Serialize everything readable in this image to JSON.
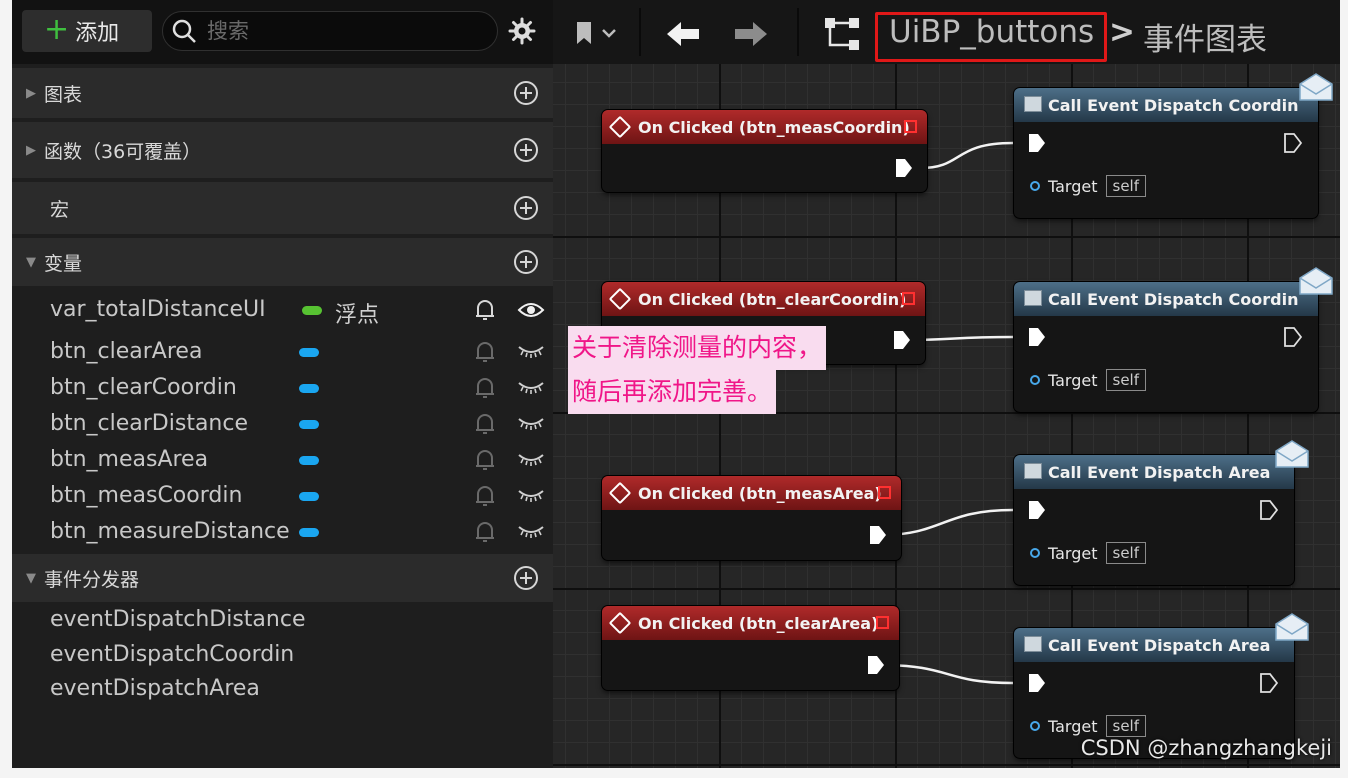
{
  "toolbar": {
    "add_label": "添加",
    "search_placeholder": "搜索"
  },
  "sections": {
    "graphs": "图表",
    "functions": "函数（36可覆盖）",
    "macros": "宏",
    "variables": "变量",
    "dispatchers": "事件分发器"
  },
  "variables": [
    {
      "name": "var_totalDistanceUI",
      "type_label": "浮点",
      "type_color": "#57c232"
    },
    {
      "name": "btn_clearArea",
      "type_color": "#1aa6f0"
    },
    {
      "name": "btn_clearCoordin",
      "type_color": "#1aa6f0"
    },
    {
      "name": "btn_clearDistance",
      "type_color": "#1aa6f0"
    },
    {
      "name": "btn_measArea",
      "type_color": "#1aa6f0"
    },
    {
      "name": "btn_measCoordin",
      "type_color": "#1aa6f0"
    },
    {
      "name": "btn_measureDistance",
      "type_color": "#1aa6f0"
    }
  ],
  "event_dispatchers": [
    "eventDispatchDistance",
    "eventDispatchCoordin",
    "eventDispatchArea"
  ],
  "breadcrumb": {
    "blueprint": "UiBP_buttons",
    "separator": ">",
    "graph": "事件图表"
  },
  "nodes": {
    "events": [
      "On Clicked (btn_measCoordin)",
      "On Clicked (btn_clearCoordin)",
      "On Clicked (btn_measArea)",
      "On Clicked (btn_clearArea)"
    ],
    "calls": [
      "Call Event Dispatch Coordin",
      "Call Event Dispatch Coordin",
      "Call Event Dispatch Area",
      "Call Event Dispatch Area"
    ],
    "target_label": "Target",
    "target_value": "self"
  },
  "annotation": {
    "line1": "关于清除测量的内容，",
    "line2": "随后再添加完善。"
  },
  "watermark": "CSDN @zhangzhangkeji",
  "colors": {
    "event_header": "#b02a2a",
    "call_header": "#4d6f88",
    "highlight_box": "#e01818",
    "annotation_text": "#f01688",
    "annotation_bg": "#f9dcef"
  }
}
